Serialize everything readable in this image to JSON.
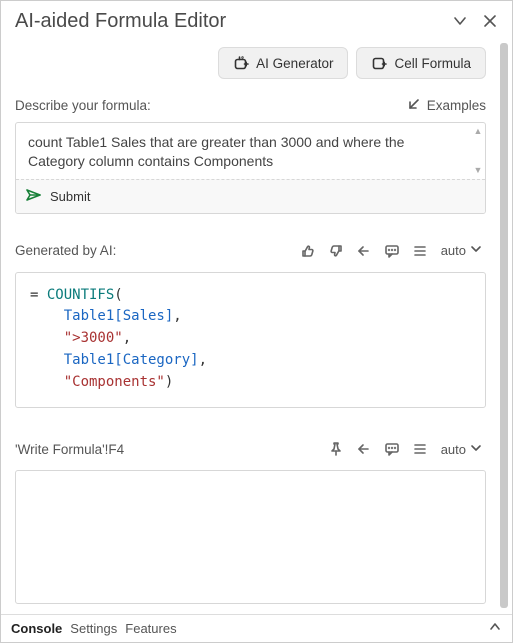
{
  "title": "AI-aided Formula Editor",
  "topButtons": {
    "aiGenerator": "AI Generator",
    "cellFormula": "Cell Formula"
  },
  "describe": {
    "label": "Describe your formula:",
    "examples": "Examples",
    "input": "count Table1 Sales that are greater than 3000 and where the Category column contains Components",
    "submit": "Submit"
  },
  "generated": {
    "label": "Generated by AI:",
    "langMode": "auto",
    "formula": {
      "eq": "= ",
      "fn": "COUNTIFS",
      "open": "(",
      "arg1": "Table1[Sales]",
      "comma": ",",
      "arg2": "\">3000\"",
      "arg3": "Table1[Category]",
      "arg4": "\"Components\"",
      "close": ")"
    }
  },
  "target": {
    "label": "'Write Formula'!F4",
    "langMode": "auto"
  },
  "footer": {
    "tabs": [
      "Console",
      "Settings",
      "Features"
    ],
    "activeIndex": 0
  },
  "colors": {
    "accentTeal": "#0b7b7b",
    "accentBlue": "#1a66c2",
    "accentRed": "#a83232",
    "submitGreen": "#188038"
  }
}
